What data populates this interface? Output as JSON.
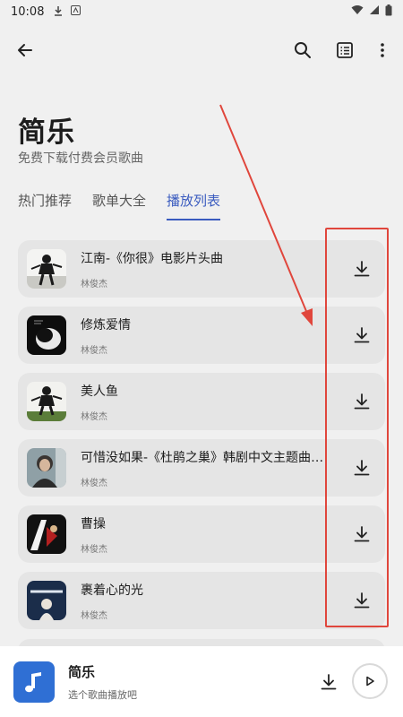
{
  "status_bar": {
    "time": "10:08"
  },
  "header": {
    "title": "简乐",
    "subtitle": "免费下载付费会员歌曲"
  },
  "tabs": [
    {
      "label": "热门推荐",
      "active": false
    },
    {
      "label": "歌单大全",
      "active": false
    },
    {
      "label": "播放列表",
      "active": true
    }
  ],
  "songs": [
    {
      "title": "江南-《你很》电影片头曲",
      "artist": "林俊杰"
    },
    {
      "title": "修炼爱情",
      "artist": "林俊杰"
    },
    {
      "title": "美人鱼",
      "artist": "林俊杰"
    },
    {
      "title": "可惜没如果-《杜鹃之巢》韩剧中文主题曲|...",
      "artist": "林俊杰"
    },
    {
      "title": "曹操",
      "artist": "林俊杰"
    },
    {
      "title": "裹着心的光",
      "artist": "林俊杰"
    }
  ],
  "player": {
    "title": "简乐",
    "subtitle": "选个歌曲播放吧"
  },
  "icons": {
    "back": "arrow-left-icon",
    "search": "search-icon",
    "list": "list-icon",
    "more": "more-vert-icon",
    "download": "download-icon",
    "play": "play-icon",
    "note": "music-note-icon"
  },
  "colors": {
    "accent": "#3a5bbf",
    "annotation": "#e0463c",
    "player_art": "#2f6fd4"
  }
}
